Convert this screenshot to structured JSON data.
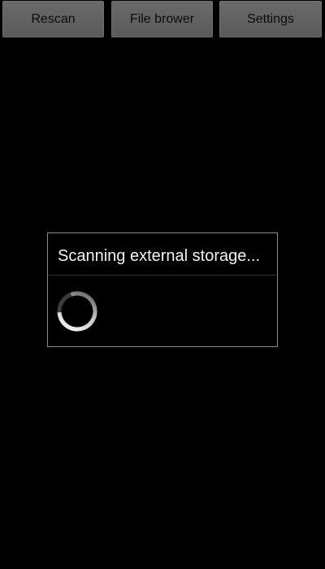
{
  "toolbar": {
    "rescan_label": "Rescan",
    "file_browser_label": "File brower",
    "settings_label": "Settings"
  },
  "dialog": {
    "message": "Scanning external storage..."
  },
  "colors": {
    "background": "#000000",
    "button": "#5f5f5f",
    "dialog_border": "#8a8a8a"
  },
  "icons": {
    "progress": "spinner-icon"
  }
}
